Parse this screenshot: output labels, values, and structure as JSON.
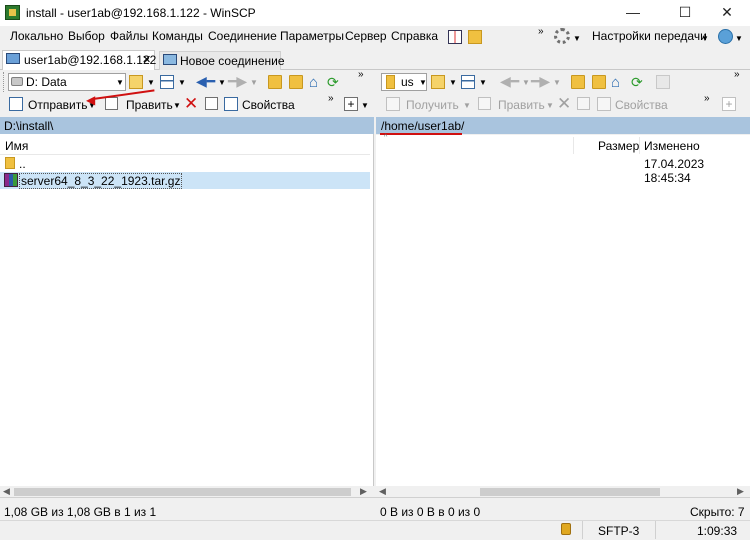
{
  "window": {
    "title": "install - user1ab@192.168.1.122 - WinSCP",
    "minimize": "—",
    "maximize": "☐",
    "close": "✕"
  },
  "menu": {
    "items": [
      "Локально",
      "Выбор",
      "Файлы",
      "Команды",
      "Соединение",
      "Параметры",
      "Сервер",
      "Справка"
    ],
    "transfer_settings": "Настройки передачи"
  },
  "tabs": {
    "session": "user1ab@192.168.1.122",
    "new_session": "Новое соединение",
    "close": "✕"
  },
  "left": {
    "drive": "D: Data",
    "toolbar": {
      "upload": "Отправить",
      "edit": "Править",
      "properties": "Свойства"
    },
    "path": "D:\\install\\",
    "column_name": "Имя",
    "files": [
      {
        "name": ".."
      },
      {
        "name": "server64_8_3_22_1923.tar.gz"
      }
    ],
    "status": "1,08 GB из 1,08 GB в 1 из 1"
  },
  "right": {
    "drive": "us",
    "toolbar": {
      "download": "Получить",
      "edit": "Править",
      "properties": "Свойства"
    },
    "path": "/home/user1ab/",
    "columns": {
      "name": "",
      "size": "Размер",
      "modified": "Изменено"
    },
    "rows": [
      {
        "name": "",
        "size": "",
        "modified": "17.04.2023 18:45:34"
      }
    ],
    "status": "0 B из 0 B в 0 из 0",
    "hidden": "Скрыто: 7"
  },
  "statusbar": {
    "protocol": "SFTP-3",
    "time": "1:09:33"
  },
  "annotation_color": "#d01010"
}
